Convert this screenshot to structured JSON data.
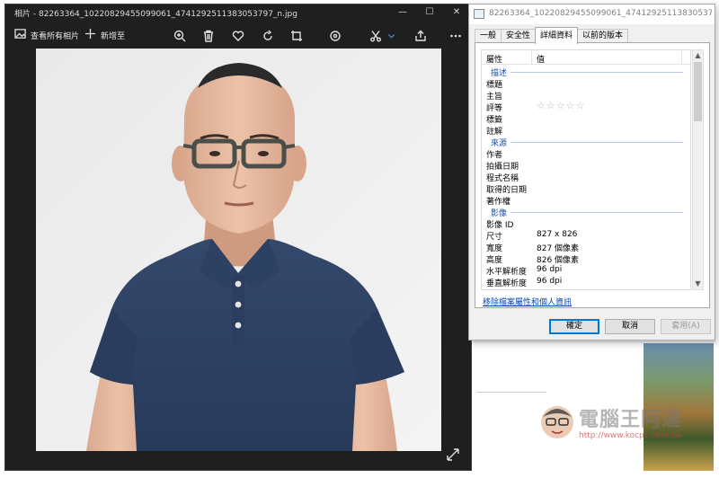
{
  "photos": {
    "title": "相片 - 82263364_10220829455099061_4741292511383053797_n.jpg",
    "toolbar": {
      "see_all": "查看所有相片",
      "add_to": "新增至"
    }
  },
  "properties": {
    "title": "82263364_10220829455099061_4741292511383053797_n.jpg",
    "tabs": [
      "一般",
      "安全性",
      "詳細資料",
      "以前的版本"
    ],
    "list_header": {
      "property": "屬性",
      "value": "值"
    },
    "groups": {
      "description": "描述",
      "origin": "來源",
      "image": "影像"
    },
    "rows": {
      "title": "標題",
      "subject": "主旨",
      "rating": "評等",
      "rating_stars": "☆☆☆☆☆",
      "tags": "標籤",
      "comments": "註解",
      "authors": "作者",
      "date_taken": "拍攝日期",
      "program_name": "程式名稱",
      "date_acquired": "取得的日期",
      "copyright": "著作權",
      "image_id": "影像 ID",
      "dimensions": "尺寸",
      "dimensions_value": "827 x 826",
      "width": "寬度",
      "width_value": "827 個像素",
      "height": "高度",
      "height_value": "826 個像素",
      "h_resolution": "水平解析度",
      "h_resolution_value": "96 dpi",
      "v_resolution": "垂直解析度",
      "v_resolution_value": "96 dpi"
    },
    "remove_link": "移除檔案屬性和個人資訊",
    "buttons": {
      "ok": "確定",
      "cancel": "取消",
      "apply": "套用(A)"
    }
  },
  "watermark": {
    "title": "電腦王阿達",
    "url": "http://www.kocpc.com.tw"
  },
  "colors": {
    "photos_bg": "#1f1f1f",
    "link_blue": "#0645ad",
    "group_blue": "#1e50a0",
    "shirt_navy": "#2c3e5c"
  }
}
